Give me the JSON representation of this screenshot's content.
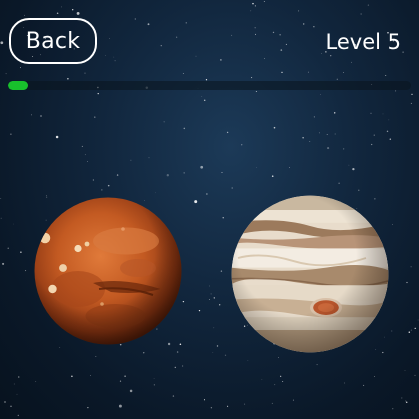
{
  "header": {
    "back_label": "Back",
    "level_label": "Level 5"
  },
  "progress": {
    "fraction": 0.05,
    "fill_color": "#18c02c"
  },
  "planets": [
    {
      "name": "mars",
      "icon": "mars-planet-icon"
    },
    {
      "name": "jupiter",
      "icon": "jupiter-planet-icon"
    }
  ],
  "colors": {
    "background": "#0f2236",
    "text": "#ffffff"
  }
}
